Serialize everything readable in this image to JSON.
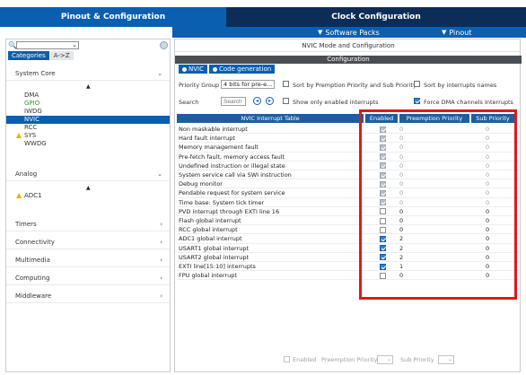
{
  "tabs": {
    "pinout": "Pinout & Configuration",
    "clock": "Clock Configuration"
  },
  "subbar": {
    "software_packs": "Software Packs",
    "pinout": "Pinout"
  },
  "left": {
    "category_tabs": [
      "Categories",
      "A->Z"
    ],
    "sections": {
      "system_core": "System Core",
      "analog": "Analog",
      "timers": "Timers",
      "connectivity": "Connectivity",
      "multimedia": "Multimedia",
      "computing": "Computing",
      "middleware": "Middleware"
    },
    "system_core_items": [
      {
        "label": "DMA",
        "style": "normal"
      },
      {
        "label": "GPIO",
        "style": "green"
      },
      {
        "label": "IWDG",
        "style": "normal"
      },
      {
        "label": "NVIC",
        "style": "selected"
      },
      {
        "label": "RCC",
        "style": "normal"
      },
      {
        "label": "SYS",
        "style": "warning"
      },
      {
        "label": "WWDG",
        "style": "normal"
      }
    ],
    "analog_items": [
      {
        "label": "ADC1",
        "style": "warning"
      }
    ]
  },
  "right": {
    "title": "NVIC Mode and Configuration",
    "config_bar": "Configuration",
    "sub_tabs": [
      "NVIC",
      "Code generation"
    ],
    "priority_group_label": "Priority Group",
    "priority_group_value": "4 bits for pre-e...",
    "sort_preemption_label": "Sort by Premption Priority and Sub Priority",
    "sort_interrupts_label": "Sort by interrupts names",
    "search_label": "Search",
    "search_placeholder": "Search",
    "show_enabled_label": "Show only enabled interrupts",
    "force_dma_label": "Force DMA channels Interrupts",
    "table_headers": [
      "NVIC Interrupt Table",
      "Enabled",
      "Preemption Priority",
      "Sub Priority"
    ],
    "rows": [
      {
        "name": "Non maskable interrupt",
        "enabled": true,
        "locked": true,
        "pre": "0",
        "sub": "0"
      },
      {
        "name": "Hard fault interrupt",
        "enabled": true,
        "locked": true,
        "pre": "0",
        "sub": "0"
      },
      {
        "name": "Memory management fault",
        "enabled": true,
        "locked": true,
        "pre": "0",
        "sub": "0"
      },
      {
        "name": "Pre-fetch fault, memory access fault",
        "enabled": true,
        "locked": true,
        "pre": "0",
        "sub": "0"
      },
      {
        "name": "Undefined instruction or illegal state",
        "enabled": true,
        "locked": true,
        "pre": "0",
        "sub": "0"
      },
      {
        "name": "System service call via SWI instruction",
        "enabled": true,
        "locked": true,
        "pre": "0",
        "sub": "0"
      },
      {
        "name": "Debug monitor",
        "enabled": true,
        "locked": true,
        "pre": "0",
        "sub": "0"
      },
      {
        "name": "Pendable request for system service",
        "enabled": true,
        "locked": true,
        "pre": "0",
        "sub": "0"
      },
      {
        "name": "Time base: System tick timer",
        "enabled": true,
        "locked": true,
        "pre": "0",
        "sub": "0"
      },
      {
        "name": "PVD interrupt through EXTI line 16",
        "enabled": false,
        "locked": false,
        "pre": "0",
        "sub": "0"
      },
      {
        "name": "Flash global interrupt",
        "enabled": false,
        "locked": false,
        "pre": "0",
        "sub": "0"
      },
      {
        "name": "RCC global interrupt",
        "enabled": false,
        "locked": false,
        "pre": "0",
        "sub": "0"
      },
      {
        "name": "ADC1 global interrupt",
        "enabled": true,
        "locked": false,
        "pre": "2",
        "sub": "0"
      },
      {
        "name": "USART1 global interrupt",
        "enabled": true,
        "locked": false,
        "pre": "2",
        "sub": "0"
      },
      {
        "name": "USART2 global interrupt",
        "enabled": true,
        "locked": false,
        "pre": "2",
        "sub": "0"
      },
      {
        "name": "EXTI line[15:10] interrupts",
        "enabled": true,
        "locked": false,
        "pre": "1",
        "sub": "0"
      },
      {
        "name": "FPU global interrupt",
        "enabled": false,
        "locked": false,
        "pre": "0",
        "sub": "0"
      }
    ],
    "bottom": {
      "enabled": "Enabled",
      "preemption": "Preemption Priority",
      "sub": "Sub Priority"
    }
  },
  "colors": {
    "primary": "#0a5fb0",
    "dark_tab": "#0c2d57",
    "highlight": "#e01919",
    "header": "#1b5ea5"
  }
}
